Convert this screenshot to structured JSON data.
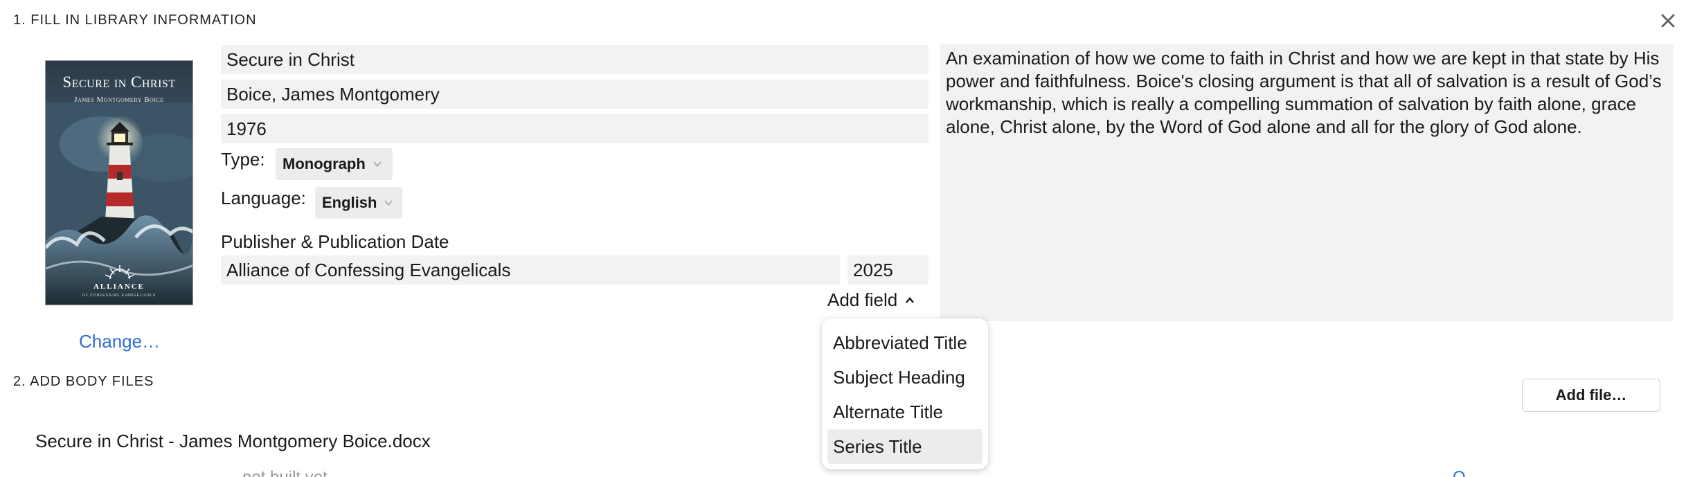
{
  "section1": {
    "heading": "1. FILL IN LIBRARY INFORMATION"
  },
  "close_icon": "close-icon",
  "cover": {
    "title": "Secure in Christ",
    "author": "James Montgomery Boice",
    "publisher": "ALLIANCE",
    "publisher_sub": "OF CONFESSING EVANGELICALS",
    "change_label": "Change…"
  },
  "fields": {
    "title": "Secure in Christ",
    "author": "Boice, James Montgomery",
    "year": "1976",
    "type_label": "Type:",
    "type_value": "Monograph",
    "language_label": "Language:",
    "language_value": "English",
    "publisher_header": "Publisher & Publication Date",
    "publisher": "Alliance of Confessing Evangelicals",
    "publication_date": "2025",
    "add_field_label": "Add field"
  },
  "description": "An examination of how we come to faith in Christ and how we are kept in that state by His power and faithfulness. Boice's closing argument is that all of salvation is a result of God’s workmanship, which is really a compelling summation of salvation by faith alone, grace alone, Christ alone, by the Word of God alone and all for the glory of God alone.",
  "add_field_menu": {
    "items": [
      "Abbreviated Title",
      "Subject Heading",
      "Alternate Title",
      "Series Title"
    ],
    "selected": "Series Title"
  },
  "section2": {
    "heading": "2. ADD BODY FILES",
    "add_file_label": "Add file…",
    "files": [
      "Secure in Christ - James Montgomery Boice.docx"
    ],
    "cutoff_text": "...not built yet...",
    "cutoff_link": "O..."
  },
  "colors": {
    "link": "#2c6ed5",
    "field_bg": "#f2f2f2",
    "select_bg": "#ececec"
  }
}
